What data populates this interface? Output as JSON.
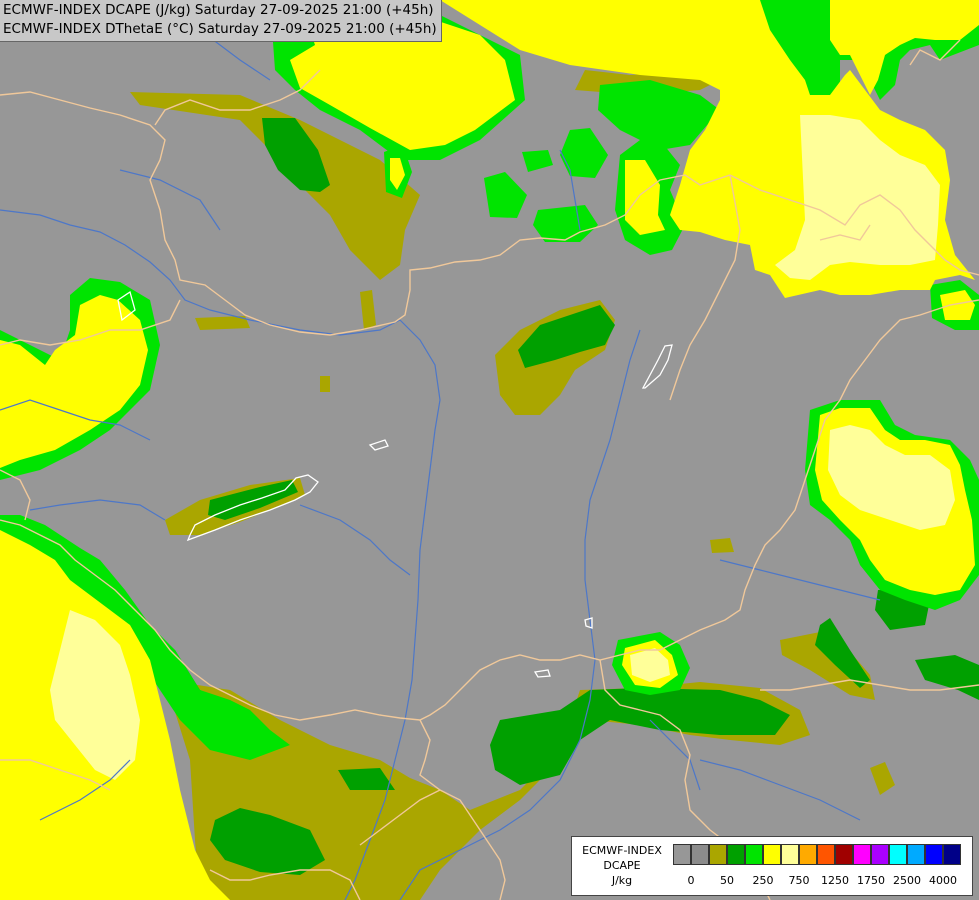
{
  "header": {
    "line1": "ECMWF-INDEX DCAPE (J/kg) Saturday 27-09-2025 21:00 (+45h)",
    "line2": "ECMWF-INDEX DThetaE (°C) Saturday 27-09-2025 21:00 (+45h)"
  },
  "legend": {
    "line1": "ECMWF-INDEX",
    "line2": "DCAPE",
    "line3": "J/kg",
    "colors": [
      "#979797",
      "#8c8c8c",
      "#aaa600",
      "#00a000",
      "#00e400",
      "#ffff00",
      "#ffff99",
      "#ffaa00",
      "#ff5500",
      "#a00000",
      "#ff00ff",
      "#aa00ff",
      "#00ffff",
      "#00aaff",
      "#0000ff",
      "#000088"
    ],
    "ticks": [
      {
        "label": "0",
        "index": 1
      },
      {
        "label": "50",
        "index": 3
      },
      {
        "label": "250",
        "index": 5
      },
      {
        "label": "750",
        "index": 7
      },
      {
        "label": "1250",
        "index": 9
      },
      {
        "label": "1750",
        "index": 11
      },
      {
        "label": "2500",
        "index": 13
      },
      {
        "label": "4000",
        "index": 15
      }
    ]
  },
  "colors": {
    "background": "#979797",
    "olive": "#aaa600",
    "dark_green": "#00a000",
    "green": "#00e400",
    "yellow": "#ffff00",
    "light_yellow": "#ffff99",
    "border": "#f0c89a",
    "river": "#4d77c8",
    "lake": "#ffffff"
  }
}
